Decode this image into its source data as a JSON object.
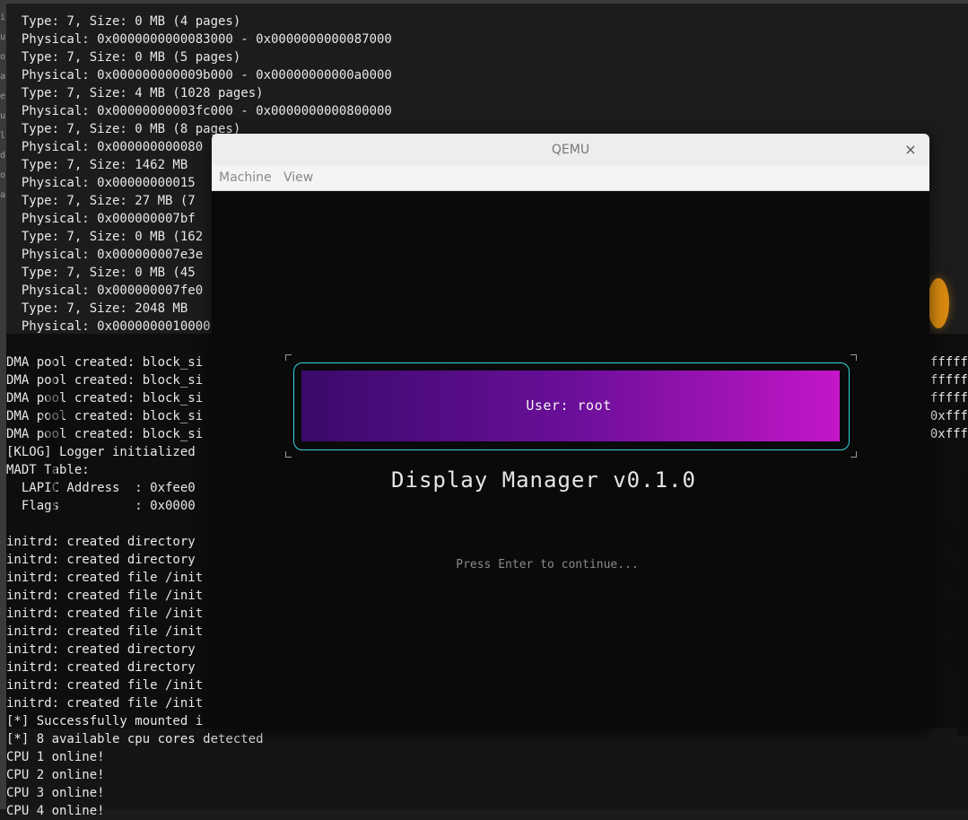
{
  "window": {
    "title": "QEMU",
    "close_glyph": "×",
    "menu": [
      "Machine",
      "View"
    ]
  },
  "display_manager": {
    "user_label": "User: root",
    "title": "Display Manager v0.1.0",
    "prompt": "Press Enter to continue..."
  },
  "terminal": {
    "lines": [
      "  Type: 7, Size: 0 MB (4 pages)",
      "  Physical: 0x0000000000083000 - 0x0000000000087000",
      "  Type: 7, Size: 0 MB (5 pages)",
      "  Physical: 0x000000000009b000 - 0x00000000000a0000",
      "  Type: 7, Size: 4 MB (1028 pages)",
      "  Physical: 0x00000000003fc000 - 0x0000000000800000",
      "  Type: 7, Size: 0 MB (8 pages)",
      "  Physical: 0x000000000080",
      "  Type: 7, Size: 1462 MB",
      "  Physical: 0x00000000015",
      "  Type: 7, Size: 27 MB (7",
      "  Physical: 0x000000007bf",
      "  Type: 7, Size: 0 MB (162",
      "  Physical: 0x000000007e3e",
      "  Type: 7, Size: 0 MB (45",
      "  Physical: 0x000000007fe0",
      "  Type: 7, Size: 2048 MB",
      "  Physical: 0x0000000010000",
      "",
      "DMA pool created: block_si",
      "DMA pool created: block_si",
      "DMA pool created: block_si",
      "DMA pool created: block_si",
      "DMA pool created: block_si",
      "[KLOG] Logger initialized",
      "MADT Table:",
      "  LAPIC Address  : 0xfee0",
      "  Flags          : 0x0000",
      "",
      "initrd: created directory",
      "initrd: created directory",
      "initrd: created file /init",
      "initrd: created file /init",
      "initrd: created file /init",
      "initrd: created file /init",
      "initrd: created directory",
      "initrd: created directory",
      "initrd: created file /init",
      "initrd: created file /init",
      "[*] Successfully mounted i",
      "[*] 8 available cpu cores detected",
      "CPU 1 online!",
      "CPU 2 online!",
      "CPU 3 online!",
      "CPU 4 online!"
    ],
    "right_lines": [
      "fffff",
      "fffff",
      "fffff",
      "0xfff",
      "0xfff"
    ]
  },
  "colors": {
    "panel_gradient_start": "#3a0a6a",
    "panel_gradient_end": "#c416c8",
    "panel_border": "#33d6e0",
    "moon": "#d88a10"
  }
}
